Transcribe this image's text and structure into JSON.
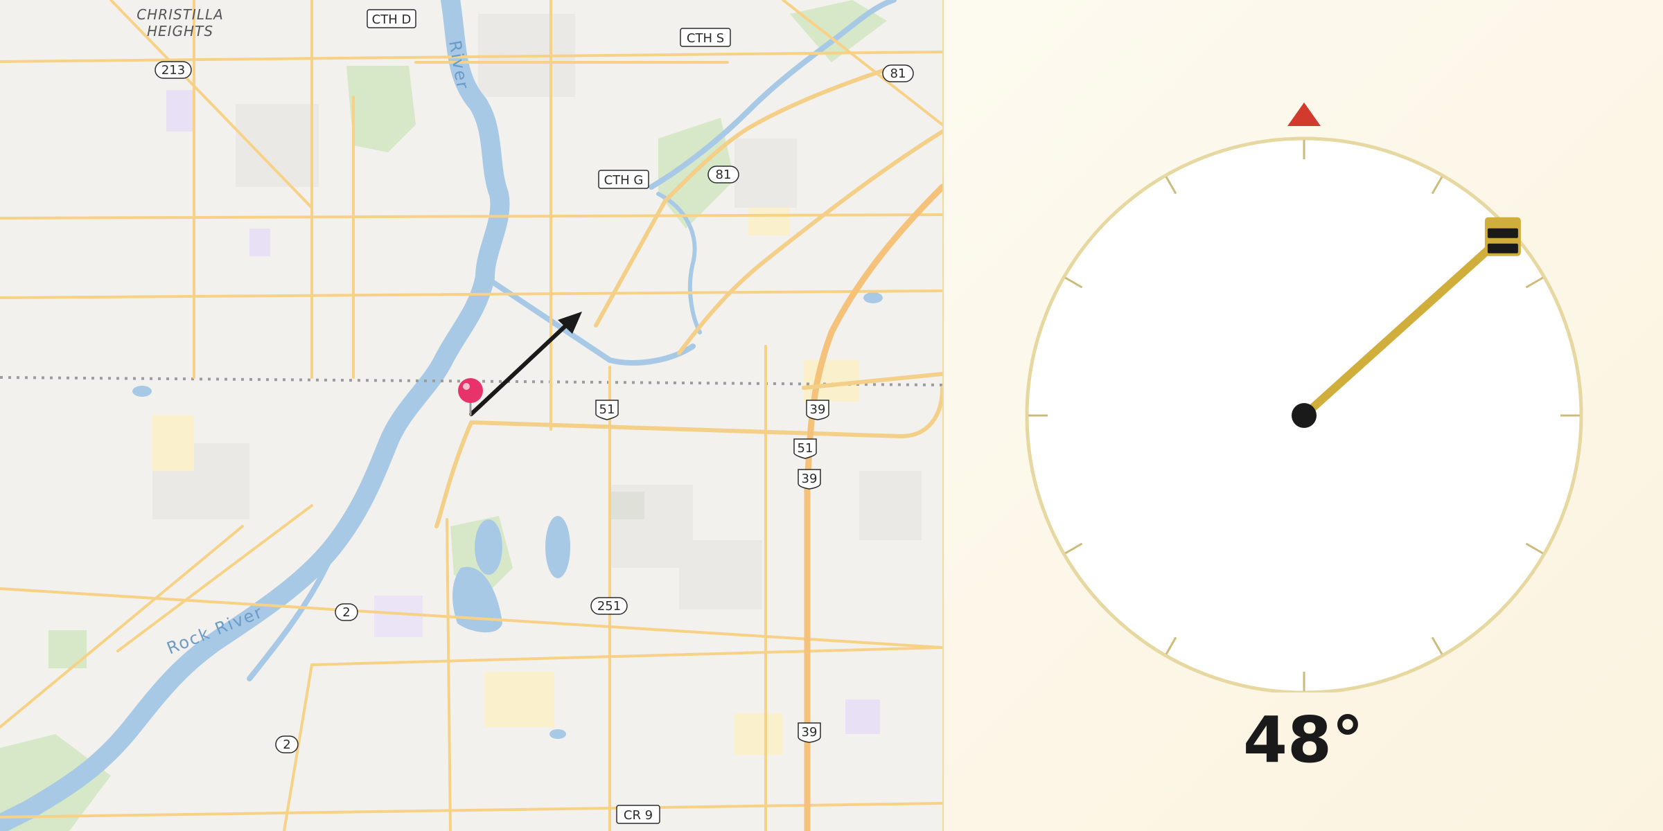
{
  "map": {
    "place_labels": [
      {
        "name": "CHRISTILLA"
      },
      {
        "name": "HEIGHTS"
      }
    ],
    "road_labels": [
      "CTH D",
      "CTH S",
      "CTH G",
      "81",
      "81",
      "213",
      "51",
      "39",
      "51",
      "39",
      "39",
      "2",
      "2",
      "251",
      "CR 9"
    ],
    "river_labels": [
      "River",
      "Rock River"
    ],
    "pin_color": "#e8336a",
    "arrow_color": "#1a1a1a"
  },
  "compass": {
    "heading_deg": 48,
    "heading_text": "48°",
    "north_marker_color": "#d23a2e",
    "needle_color": "#cfae3c",
    "dial_color": "#e6d8a0"
  }
}
